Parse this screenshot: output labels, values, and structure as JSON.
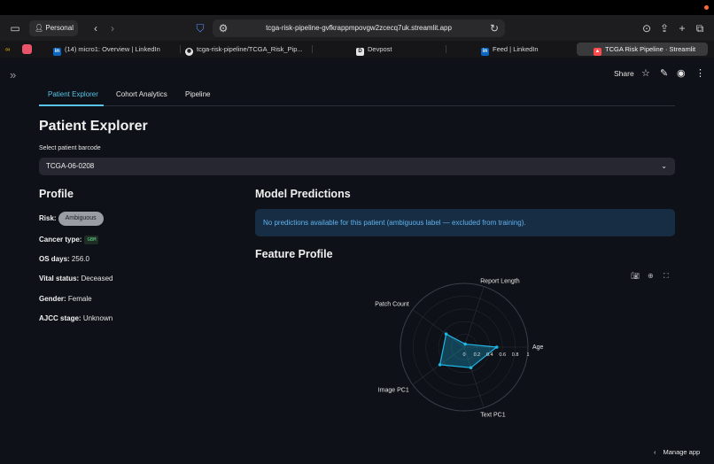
{
  "browser": {
    "profile_label": "Personal",
    "url": "tcga-risk-pipeline-gvfkrappmpovgw2zcecq7uk.streamlit.app",
    "tabs": [
      {
        "label": "(14) micro1: Overview | LinkedIn",
        "icon": "linkedin-icon",
        "active": false
      },
      {
        "label": "tcga-risk-pipeline/TCGA_Risk_Pip...",
        "icon": "github-icon",
        "active": false
      },
      {
        "label": "Devpost",
        "icon": "devpost-icon",
        "active": false
      },
      {
        "label": "Feed | LinkedIn",
        "icon": "linkedin-icon",
        "active": false
      },
      {
        "label": "TCGA Risk Pipeline · Streamlit",
        "icon": "streamlit-icon",
        "active": true
      }
    ]
  },
  "header": {
    "share_label": "Share"
  },
  "tabs": [
    {
      "label": "Patient Explorer",
      "active": true
    },
    {
      "label": "Cohort Analytics",
      "active": false
    },
    {
      "label": "Pipeline",
      "active": false
    }
  ],
  "page_title": "Patient Explorer",
  "select": {
    "label": "Select patient barcode",
    "value": "TCGA-06-0208"
  },
  "profile": {
    "heading": "Profile",
    "risk_label": "Risk:",
    "risk_value": "Ambiguous",
    "cancer_type_label": "Cancer type:",
    "cancer_type_value": "GBM",
    "os_days_label": "OS days:",
    "os_days_value": "256.0",
    "vital_label": "Vital status:",
    "vital_value": "Deceased",
    "gender_label": "Gender:",
    "gender_value": "Female",
    "ajcc_label": "AJCC stage:",
    "ajcc_value": "Unknown"
  },
  "predictions": {
    "heading": "Model Predictions",
    "info": "No predictions available for this patient (ambiguous label — excluded from training)."
  },
  "feature_profile": {
    "heading": "Feature Profile"
  },
  "chart_data": {
    "type": "radar",
    "axes": [
      "Age",
      "Report Length",
      "Patch Count",
      "Image PC1",
      "Text PC1"
    ],
    "radial_ticks": [
      "0",
      "0.2",
      "0.4",
      "0.6",
      "0.8",
      "1"
    ],
    "range": [
      0,
      1
    ],
    "series": [
      {
        "values": [
          0.51,
          0.05,
          0.35,
          0.47,
          0.34
        ]
      }
    ],
    "colors": {
      "line": "#1fb6e6",
      "fill": "#1fb6e6"
    }
  },
  "footer": {
    "manage_label": "Manage app"
  }
}
